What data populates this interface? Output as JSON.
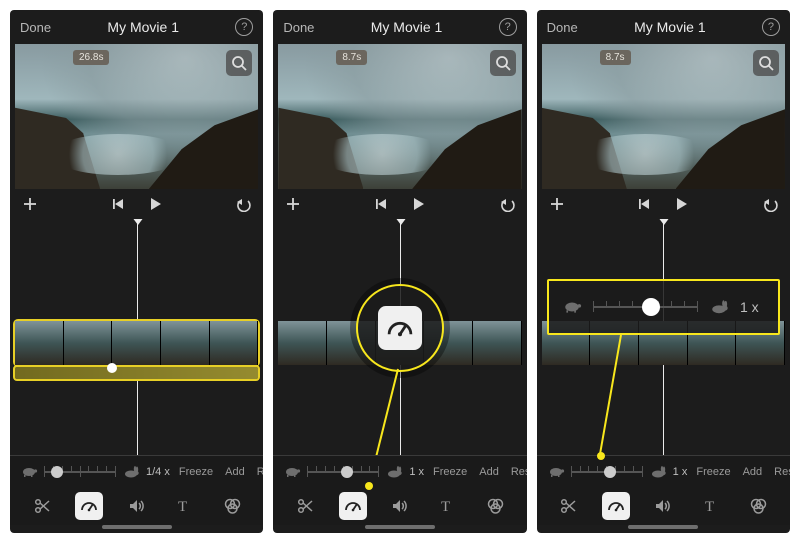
{
  "screens": [
    {
      "header": {
        "done": "Done",
        "title": "My Movie 1"
      },
      "preview": {
        "duration_badge": "26.8s"
      },
      "speed": {
        "value_label": "1/4 x",
        "slider_pos": 0.18
      },
      "actions": {
        "freeze": "Freeze",
        "add": "Add",
        "reset": "Reset"
      },
      "tools": {
        "active": "speed"
      },
      "clip_selected": true,
      "speedbar": {
        "visible": true,
        "handle_pos": 0.38
      }
    },
    {
      "header": {
        "done": "Done",
        "title": "My Movie 1"
      },
      "preview": {
        "duration_badge": "8.7s"
      },
      "speed": {
        "value_label": "1 x",
        "slider_pos": 0.55
      },
      "actions": {
        "freeze": "Freeze",
        "add": "Add",
        "reset": "Reset"
      },
      "tools": {
        "active": "speed"
      },
      "clip_selected": false,
      "speedbar": {
        "visible": false
      },
      "callout": "speed-tool"
    },
    {
      "header": {
        "done": "Done",
        "title": "My Movie 1"
      },
      "preview": {
        "duration_badge": "8.7s"
      },
      "speed": {
        "value_label": "1 x",
        "slider_pos": 0.55
      },
      "actions": {
        "freeze": "Freeze",
        "add": "Add",
        "reset": "Reset"
      },
      "tools": {
        "active": "speed"
      },
      "clip_selected": false,
      "speedbar": {
        "visible": false
      },
      "callout": "speed-slider",
      "callout_slider": {
        "value_label": "1 x",
        "slider_pos": 0.55
      }
    }
  ],
  "icons": {
    "help": "?",
    "magnify": "search-icon",
    "add": "plus-icon",
    "prev": "skip-back-icon",
    "play": "play-icon",
    "undo": "undo-icon",
    "turtle": "turtle-icon",
    "rabbit": "rabbit-icon",
    "scissors": "scissors-icon",
    "speed": "speedometer-icon",
    "volume": "volume-icon",
    "text": "text-icon",
    "filters": "filters-icon"
  }
}
